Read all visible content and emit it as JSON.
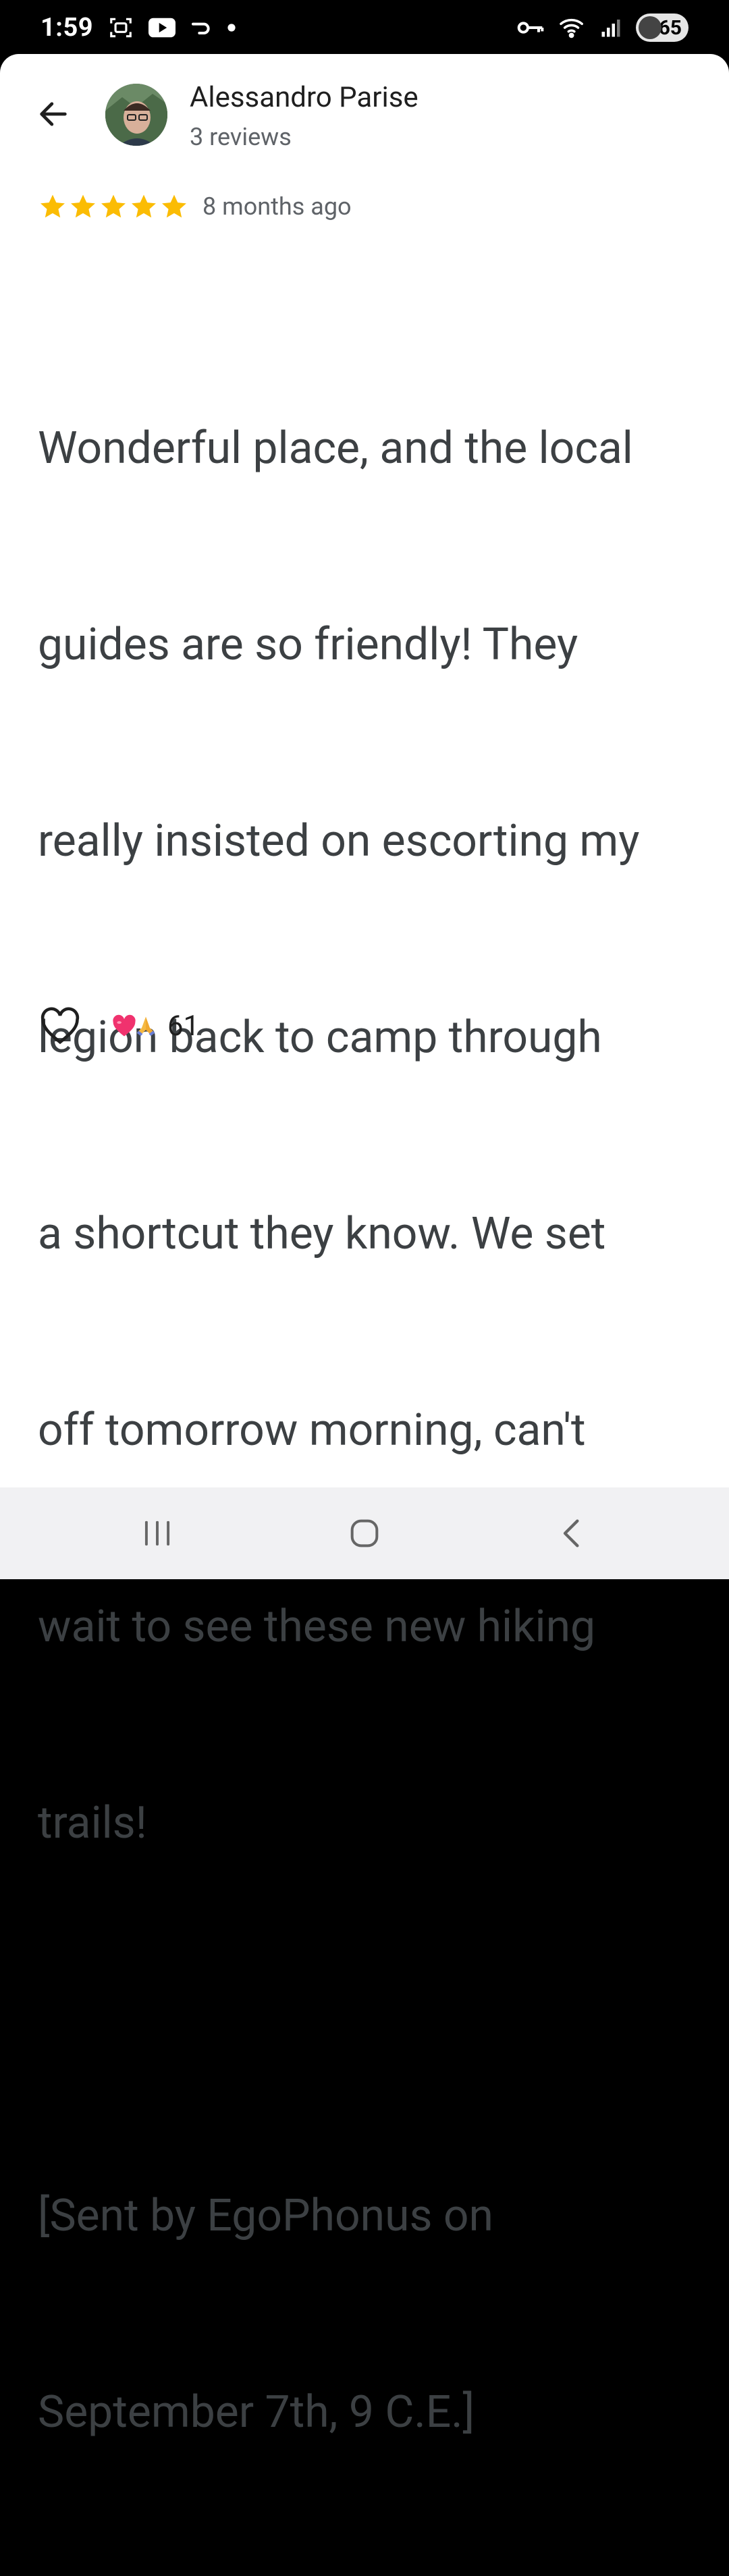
{
  "status_bar": {
    "time": "1:59",
    "battery_level": "65",
    "icons": [
      "screenshot-icon",
      "youtube-icon",
      "link-icon",
      "notification-dot-icon",
      "vpn-key-icon",
      "wifi-icon",
      "signal-icon",
      "battery-icon"
    ]
  },
  "header": {
    "author_name": "Alessandro Parise",
    "author_meta": "3 reviews"
  },
  "review": {
    "rating": 5,
    "rating_max": 5,
    "time_ago": "8 months ago",
    "lines": [
      "Wonderful place, and the local",
      "guides are so friendly! They",
      "really insisted on escorting my",
      "legion back to camp through",
      "a shortcut they know. We set",
      "off tomorrow morning, can't",
      "wait to see these new hiking",
      "trails!",
      "",
      "[Sent by EgoPhonus on",
      "September 7th, 9 C.E.]"
    ]
  },
  "reactions": {
    "count": "61",
    "emoji": [
      "heart-emoji",
      "folded-hands-emoji"
    ]
  },
  "colors": {
    "star": "#FBBC04",
    "text": "#3C4043",
    "secondary": "#5F6368",
    "nav_bg": "#F1F1F3"
  }
}
